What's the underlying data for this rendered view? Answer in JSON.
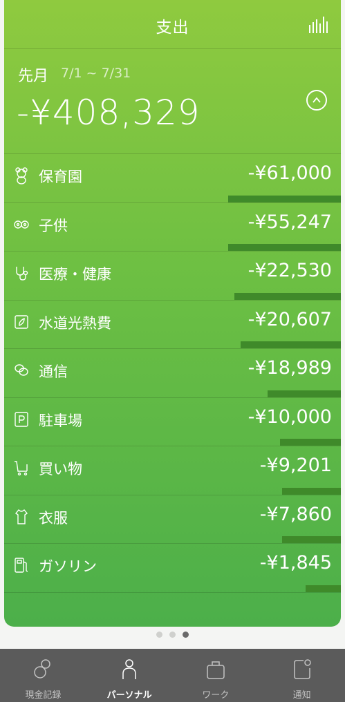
{
  "header": {
    "title": "支出",
    "chart_icon": "bar-chart-icon"
  },
  "summary": {
    "period_label": "先月",
    "period_range": "7/1 ~ 7/31",
    "total": "-¥408,329",
    "collapse_icon": "chevron-up-icon"
  },
  "categories": [
    {
      "icon": "teddy-bear-icon",
      "label": "保育園",
      "amount": "-¥61,000",
      "share": 0.54
    },
    {
      "icon": "baby-face-icon",
      "label": "子供",
      "amount": "-¥55,247",
      "share": 0.54
    },
    {
      "icon": "stethoscope-icon",
      "label": "医療・健康",
      "amount": "-¥22,530",
      "share": 0.51
    },
    {
      "icon": "utility-icon",
      "label": "水道光熱費",
      "amount": "-¥20,607",
      "share": 0.48
    },
    {
      "icon": "chat-bubbles-icon",
      "label": "通信",
      "amount": "-¥18,989",
      "share": 0.35
    },
    {
      "icon": "parking-icon",
      "label": "駐車場",
      "amount": "-¥10,000",
      "share": 0.29
    },
    {
      "icon": "cart-icon",
      "label": "買い物",
      "amount": "-¥9,201",
      "share": 0.28
    },
    {
      "icon": "clothes-icon",
      "label": "衣服",
      "amount": "-¥7,860",
      "share": 0.28
    },
    {
      "icon": "fuel-pump-icon",
      "label": "ガソリン",
      "amount": "-¥1,845",
      "share": 0.17
    }
  ],
  "pager": {
    "count": 3,
    "active": 2
  },
  "tabs": [
    {
      "label": "現金記録",
      "icon": "coins-icon",
      "active": false
    },
    {
      "label": "パーソナル",
      "icon": "person-icon",
      "active": true
    },
    {
      "label": "ワーク",
      "icon": "briefcase-icon",
      "active": false
    },
    {
      "label": "通知",
      "icon": "notification-icon",
      "active": false
    }
  ],
  "colors": {
    "card_top": "#8fca3f",
    "card_bottom": "#4caf4a",
    "bar": "#3f8a2a",
    "tabbar": "#5b5b5b"
  }
}
